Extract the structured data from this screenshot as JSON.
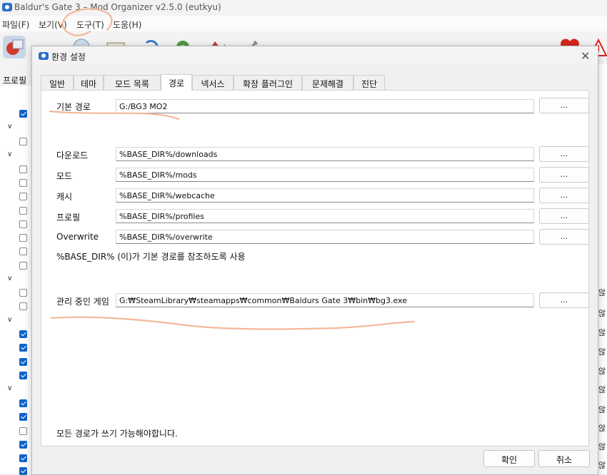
{
  "main_window": {
    "title": "Baldur's Gate 3 – Mod Organizer v2.5.0 (eutkyu)",
    "menus": [
      "파일(F)",
      "보기(V)",
      "도구(T)",
      "도움(H)"
    ],
    "profile_label": "프로필",
    "right_cells": [
      "않",
      "않",
      "않",
      "않",
      "않",
      "않",
      "않",
      "않",
      "않",
      "않",
      "않",
      "않"
    ]
  },
  "dialog": {
    "title": "환경 설정",
    "close_glyph": "✕",
    "tabs": [
      "일반",
      "테마",
      "모드 목록",
      "경로",
      "넥서스",
      "확장 플러그인",
      "문제해결",
      "진단"
    ],
    "active_tab": "경로",
    "base_path": {
      "label": "기본 경로",
      "value": "G:/BG3 MO2"
    },
    "paths": [
      {
        "label": "다운로드",
        "value": "%BASE_DIR%/downloads"
      },
      {
        "label": "모드",
        "value": "%BASE_DIR%/mods"
      },
      {
        "label": "캐시",
        "value": "%BASE_DIR%/webcache"
      },
      {
        "label": "프로필",
        "value": "%BASE_DIR%/profiles"
      },
      {
        "label": "Overwrite",
        "value": "%BASE_DIR%/overwrite"
      }
    ],
    "base_dir_note": "%BASE_DIR% (이)가 기본 경로를 참조하도록 사용",
    "managed_game": {
      "label": "관리 중인 게임",
      "value": "G:₩SteamLibrary₩steamapps₩common₩Baldurs Gate 3₩bin₩bg3.exe"
    },
    "browse_label": "...",
    "footer_note": "모든 경로가 쓰기 가능해야합니다.",
    "ok_label": "확인",
    "cancel_label": "취소"
  },
  "colors": {
    "accent": "#0f62c9",
    "annotation": "#f2b89a"
  }
}
